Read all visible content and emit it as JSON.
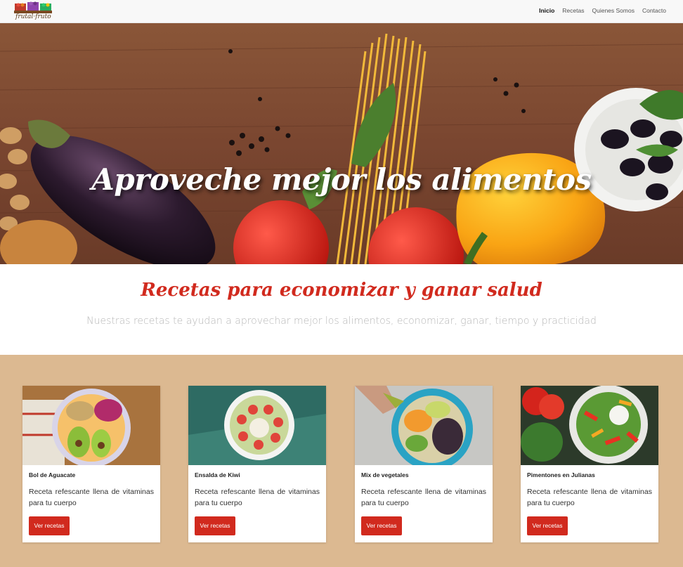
{
  "brand": {
    "logo_text": "frutal·fruto"
  },
  "nav": {
    "items": [
      {
        "label": "Inicio",
        "active": true
      },
      {
        "label": "Recetas",
        "active": false
      },
      {
        "label": "Quienes Somos",
        "active": false
      },
      {
        "label": "Contacto",
        "active": false
      }
    ]
  },
  "hero": {
    "title": "Aproveche mejor los alimentos"
  },
  "intro": {
    "title": "Recetas para economizar y ganar salud",
    "subtitle": "Nuestras recetas te ayudan a aprovechar mejor los alimentos, economizar, ganar, tiempo y practicidad"
  },
  "cards": [
    {
      "title": "Bol de Aguacate",
      "text": "Receta refescante llena de vitaminas para tu cuerpo",
      "button": "Ver recetas"
    },
    {
      "title": "Ensalda de Kiwi",
      "text": "Receta refescante llena de vitaminas para tu cuerpo",
      "button": "Ver recetas"
    },
    {
      "title": "Mix de vegetales",
      "text": "Receta refescante llena de vitaminas para tu cuerpo",
      "button": "Ver recetas"
    },
    {
      "title": "Pimentones en Julianas",
      "text": "Receta refescante llena de vitaminas para tu cuerpo",
      "button": "Ver recetas"
    }
  ],
  "colors": {
    "accent": "#d12a1e",
    "section_bg": "#dcb991",
    "navbar_bg": "#f8f8f8"
  }
}
